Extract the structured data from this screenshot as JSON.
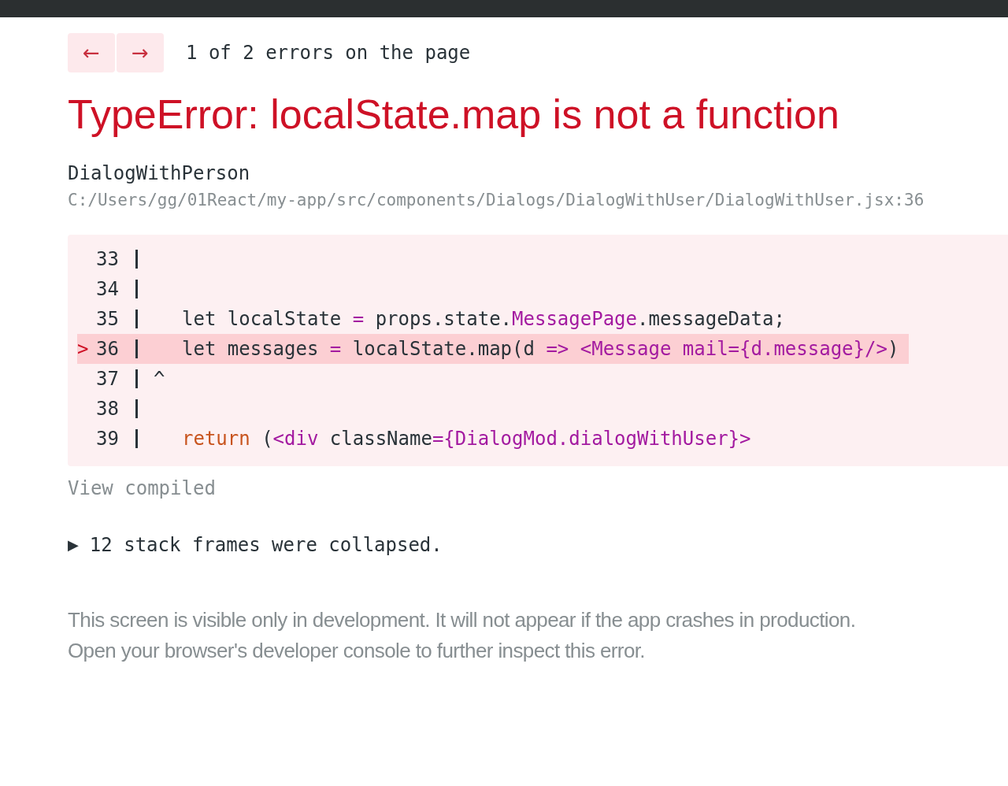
{
  "nav": {
    "prev": "←",
    "next": "→",
    "counter": "1 of 2 errors on the page"
  },
  "error_title": "TypeError: localState.map is not a function",
  "component": "DialogWithPerson",
  "file_path": "C:/Users/gg/01React/my-app/src/components/Dialogs/DialogWithUser/DialogWithUser.jsx:36",
  "code_frame": {
    "lines": [
      {
        "number": "33",
        "highlighted": false
      },
      {
        "number": "34",
        "highlighted": false
      },
      {
        "number": "35",
        "highlighted": false,
        "tokens": [
          {
            "kind": "plain",
            "text": "let localState "
          },
          {
            "kind": "operator",
            "text": "="
          },
          {
            "kind": "plain",
            "text": " props.state."
          },
          {
            "kind": "jsx",
            "text": "MessagePage"
          },
          {
            "kind": "plain",
            "text": ".messageData;"
          }
        ]
      },
      {
        "number": "36",
        "highlighted": true,
        "marker": ">",
        "tokens": [
          {
            "kind": "plain",
            "text": "let messages "
          },
          {
            "kind": "operator",
            "text": "="
          },
          {
            "kind": "plain",
            "text": " localState.map(d "
          },
          {
            "kind": "operator",
            "text": "=>"
          },
          {
            "kind": "jsx",
            "text": " <Message mail={d.message}/>"
          },
          {
            "kind": "plain",
            "text": ")"
          }
        ]
      },
      {
        "number": "37",
        "highlighted": false,
        "caret": "^"
      },
      {
        "number": "38",
        "highlighted": false
      },
      {
        "number": "39",
        "highlighted": false,
        "tokens": [
          {
            "kind": "keyword",
            "text": "return"
          },
          {
            "kind": "plain",
            "text": " ("
          },
          {
            "kind": "jsx",
            "text": "<div"
          },
          {
            "kind": "plain",
            "text": " className"
          },
          {
            "kind": "operator",
            "text": "="
          },
          {
            "kind": "jsx",
            "text": "{DialogMod.dialogWithUser}>"
          }
        ]
      }
    ]
  },
  "view_compiled": "View compiled",
  "stack": {
    "toggle": "▶",
    "label": "12 stack frames were collapsed."
  },
  "footer": [
    "This screen is visible only in development. It will not appear if the app crashes in production.",
    "Open your browser's developer console to further inspect this error."
  ]
}
